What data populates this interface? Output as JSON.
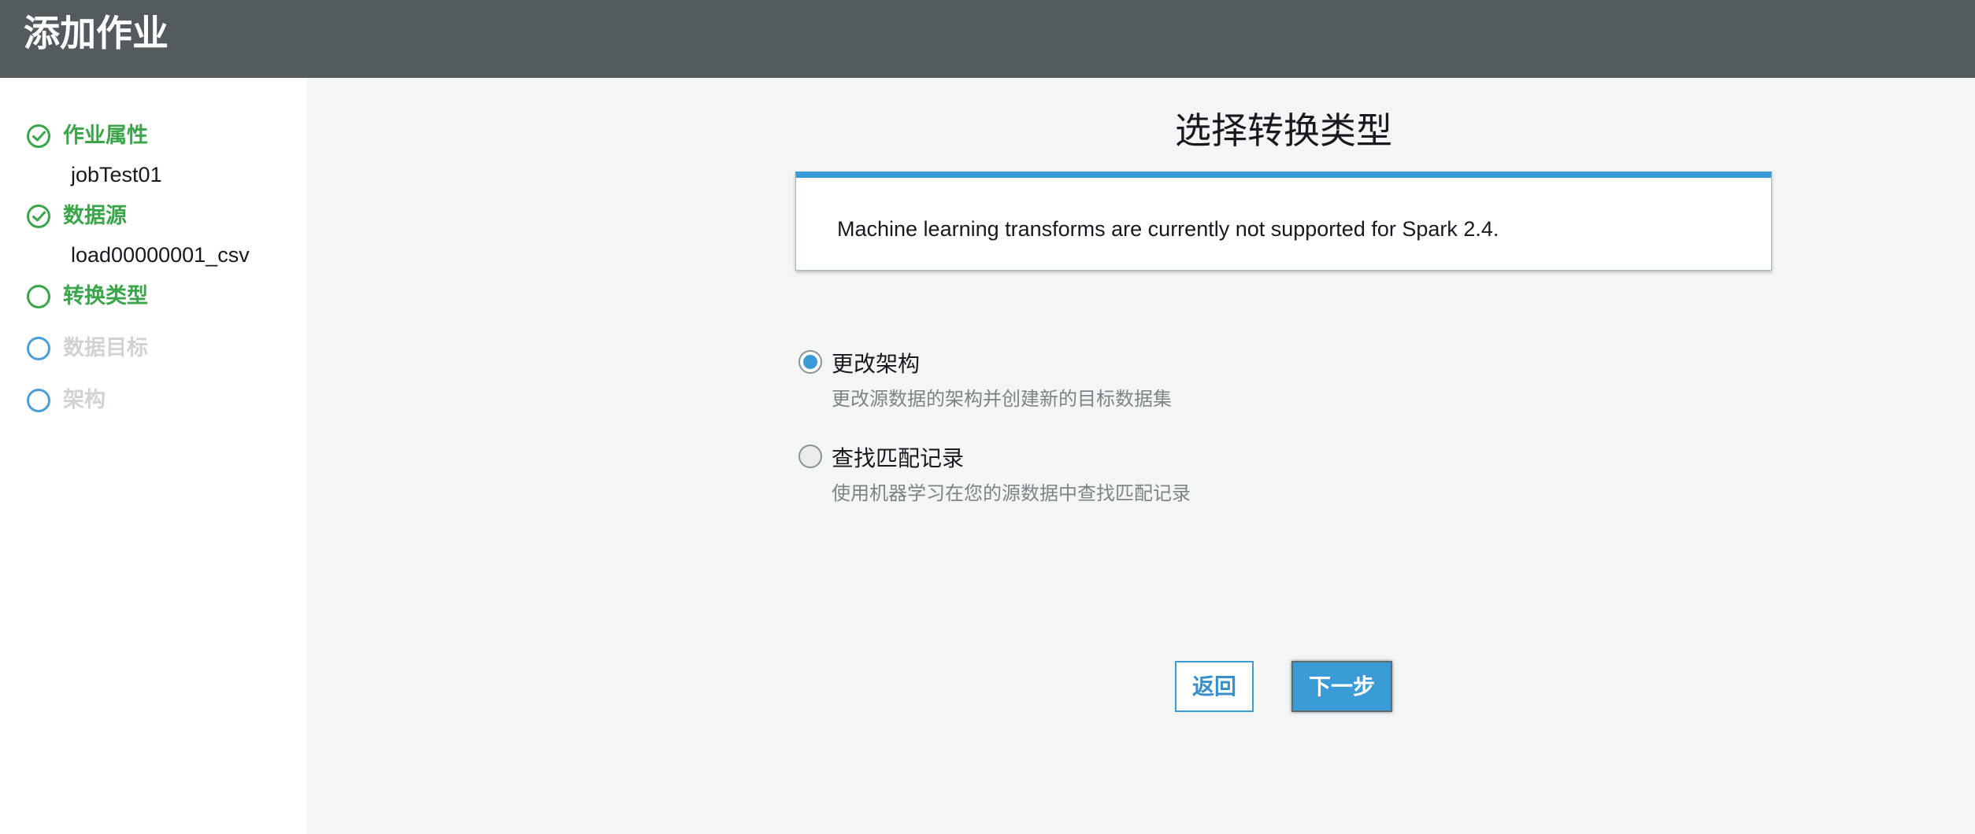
{
  "header": {
    "title": "添加作业"
  },
  "sidebar": {
    "steps": [
      {
        "label": "作业属性",
        "sub": "jobTest01",
        "state": "done"
      },
      {
        "label": "数据源",
        "sub": "load00000001_csv",
        "state": "done"
      },
      {
        "label": "转换类型",
        "state": "current"
      },
      {
        "label": "数据目标",
        "state": "todo"
      },
      {
        "label": "架构",
        "state": "todo"
      }
    ]
  },
  "main": {
    "title": "选择转换类型",
    "info": "Machine learning transforms are currently not supported for Spark 2.4.",
    "options": [
      {
        "label": "更改架构",
        "description": "更改源数据的架构并创建新的目标数据集",
        "selected": true
      },
      {
        "label": "查找匹配记录",
        "description": "使用机器学习在您的源数据中查找匹配记录",
        "selected": false
      }
    ],
    "back_label": "返回",
    "next_label": "下一步"
  },
  "colors": {
    "header_bg": "#545b5f",
    "done_green": "#3aa54a",
    "accent_blue": "#3a9bd6",
    "todo_gray": "#cfd3d6"
  }
}
